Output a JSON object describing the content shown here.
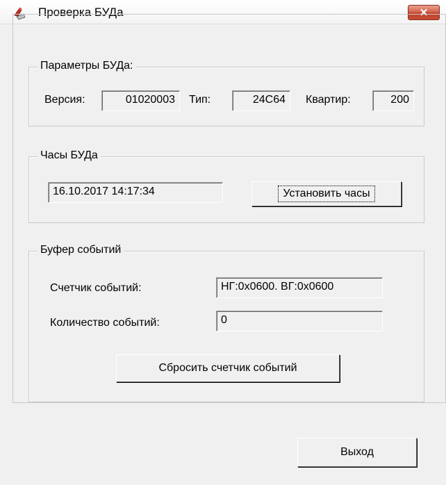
{
  "window": {
    "title": "Проверка БУДа",
    "close_glyph": "✕"
  },
  "params": {
    "legend": "Параметры БУДа:",
    "version_label": "Версия:",
    "version_value": "01020003",
    "type_label": "Тип:",
    "type_value": "24C64",
    "apartments_label": "Квартир:",
    "apartments_value": "200"
  },
  "clock": {
    "legend": "Часы БУДа",
    "datetime_value": "16.10.2017 14:17:34",
    "set_button_label": "Установить часы"
  },
  "events": {
    "legend": "Буфер событий",
    "counter_label": "Счетчик событий:",
    "counter_value": "НГ:0x0600.  ВГ:0x0600",
    "count_label": "Количество событий:",
    "count_value": "0",
    "reset_button_label": "Сбросить счетчик событий"
  },
  "footer": {
    "exit_button_label": "Выход"
  },
  "colors": {
    "window_bg": "#f0f0f0",
    "close_button": "#c84e36"
  }
}
